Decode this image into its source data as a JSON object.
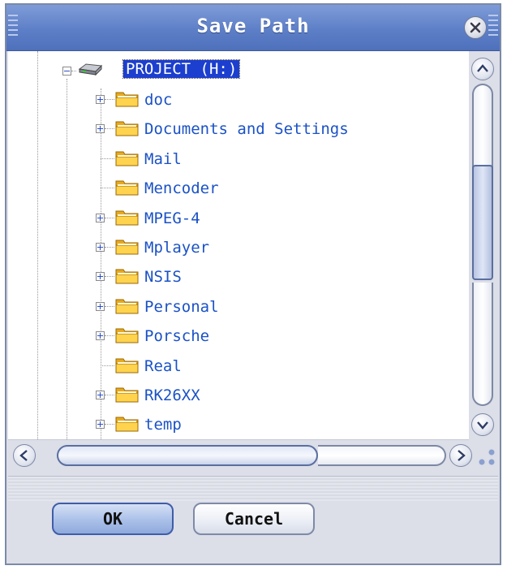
{
  "dialog": {
    "title": "Save Path",
    "close_icon": "close-icon"
  },
  "tree": {
    "root": {
      "label": "PROJECT (H:)",
      "icon": "drive-icon",
      "expanded": true,
      "selected": true
    },
    "children": [
      {
        "label": "doc",
        "has_children": true
      },
      {
        "label": "Documents and Settings",
        "has_children": true
      },
      {
        "label": "Mail",
        "has_children": false
      },
      {
        "label": "Mencoder",
        "has_children": false
      },
      {
        "label": "MPEG-4",
        "has_children": true
      },
      {
        "label": "Mplayer",
        "has_children": true
      },
      {
        "label": "NSIS",
        "has_children": true
      },
      {
        "label": "Personal",
        "has_children": true
      },
      {
        "label": "Porsche",
        "has_children": true
      },
      {
        "label": "Real",
        "has_children": false
      },
      {
        "label": "RK26XX",
        "has_children": true
      },
      {
        "label": "temp",
        "has_children": true
      }
    ]
  },
  "buttons": {
    "ok": "OK",
    "cancel": "Cancel"
  },
  "colors": {
    "title_bar": "#5d7fc7",
    "selection": "#1c3fcf",
    "tree_text": "#1b52c6"
  }
}
